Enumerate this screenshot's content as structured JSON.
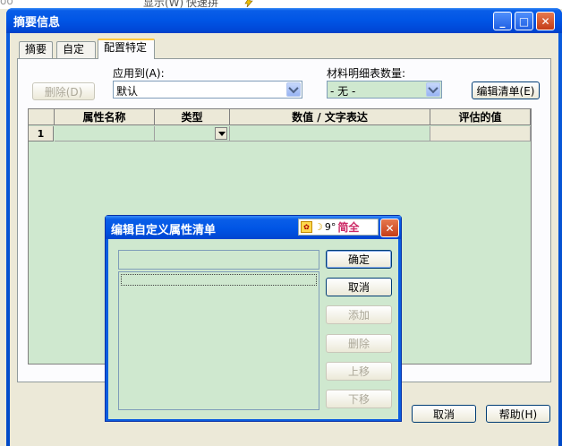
{
  "background_texts": [
    "oo",
    "显示(W)",
    "快速拼",
    ""
  ],
  "window": {
    "title": "摘要信息",
    "controls": {
      "minimize": "_",
      "maximize": "□",
      "close": "✕"
    }
  },
  "tabs": [
    {
      "label": "摘要"
    },
    {
      "label": "自定义"
    },
    {
      "label": "配置特定",
      "active": true
    }
  ],
  "form": {
    "delete_button": "删除(D)",
    "apply_to_label": "应用到(A):",
    "apply_to_value": "默认",
    "bom_qty_label": "材料明细表数量:",
    "bom_qty_value": "- 无 -",
    "edit_list_button": "编辑清单(E)"
  },
  "grid": {
    "columns": [
      "属性名称",
      "类型",
      "数值 / 文字表达",
      "评估的值"
    ],
    "rows": [
      {
        "number": "1",
        "name": "",
        "type": "",
        "value": "",
        "evaluated": ""
      }
    ]
  },
  "bottom_buttons": {
    "cancel": "取消",
    "help": "帮助(H)"
  },
  "dialog": {
    "title": "编辑自定义属性清单",
    "ime": {
      "mode_text": "简全",
      "punct": "9°"
    },
    "input_value": "",
    "buttons": {
      "ok": "确定",
      "cancel": "取消",
      "add": "添加",
      "delete": "删除",
      "move_up": "上移",
      "move_down": "下移"
    }
  }
}
